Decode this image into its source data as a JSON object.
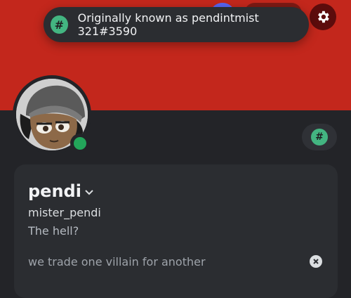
{
  "banner": {
    "color": "#c3271c"
  },
  "tooltip": {
    "icon": "hash-icon",
    "text": "Originally known as pendintmist 321#3590"
  },
  "settings": {
    "icon": "gear-icon"
  },
  "profile": {
    "display_name": "pendi",
    "username": "mister_pendi",
    "pronouns": "The hell?",
    "custom_status": "we trade one villain for another",
    "status": "online",
    "status_color": "#23a55a"
  },
  "badge": {
    "icon": "hash-icon",
    "color": "#43b581"
  },
  "hash_glyph": "#"
}
